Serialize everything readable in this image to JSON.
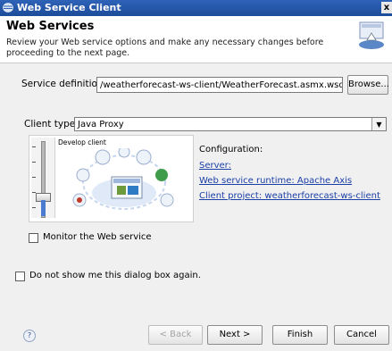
{
  "window": {
    "title": "Web Service Client",
    "close": "x"
  },
  "banner": {
    "heading": "Web Services",
    "description": "Review your Web service options and make any necessary changes before proceeding to the next page."
  },
  "service": {
    "label": "Service definition:",
    "value": "/weatherforecast-ws-client/WeatherForecast.asmx.wsdl",
    "browse": "Browse..."
  },
  "client": {
    "label": "Client type:",
    "value": "Java Proxy",
    "slider_caption": "Develop client"
  },
  "configuration": {
    "label": "Configuration:",
    "server": "Server:",
    "runtime": "Web service runtime: Apache Axis",
    "project": "Client project: weatherforecast-ws-client"
  },
  "monitor_label": "Monitor the Web service",
  "dont_show_label": "Do not show me this dialog box again.",
  "buttons": {
    "back": "< Back",
    "next": "Next >",
    "finish": "Finish",
    "cancel": "Cancel",
    "help": "?"
  }
}
